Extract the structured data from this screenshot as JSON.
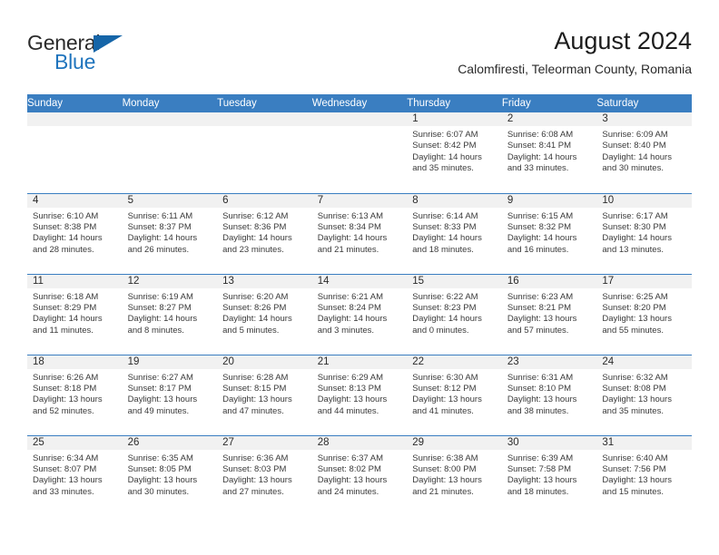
{
  "brand": {
    "name_part1": "General",
    "name_part2": "Blue",
    "logo_icon": "blue-triangle-logo",
    "accent_color": "#1f74bd"
  },
  "header": {
    "title": "August 2024",
    "subtitle": "Calomfiresti, Teleorman County, Romania"
  },
  "calendar": {
    "header_bg": "#3a7ec1",
    "daynum_bg": "#f1f1f1",
    "weekday_headers": [
      "Sunday",
      "Monday",
      "Tuesday",
      "Wednesday",
      "Thursday",
      "Friday",
      "Saturday"
    ],
    "weeks": [
      [
        {
          "day": "",
          "sunrise": "",
          "sunset": "",
          "daylight_line1": "",
          "daylight_line2": ""
        },
        {
          "day": "",
          "sunrise": "",
          "sunset": "",
          "daylight_line1": "",
          "daylight_line2": ""
        },
        {
          "day": "",
          "sunrise": "",
          "sunset": "",
          "daylight_line1": "",
          "daylight_line2": ""
        },
        {
          "day": "",
          "sunrise": "",
          "sunset": "",
          "daylight_line1": "",
          "daylight_line2": ""
        },
        {
          "day": "1",
          "sunrise": "Sunrise: 6:07 AM",
          "sunset": "Sunset: 8:42 PM",
          "daylight_line1": "Daylight: 14 hours",
          "daylight_line2": "and 35 minutes."
        },
        {
          "day": "2",
          "sunrise": "Sunrise: 6:08 AM",
          "sunset": "Sunset: 8:41 PM",
          "daylight_line1": "Daylight: 14 hours",
          "daylight_line2": "and 33 minutes."
        },
        {
          "day": "3",
          "sunrise": "Sunrise: 6:09 AM",
          "sunset": "Sunset: 8:40 PM",
          "daylight_line1": "Daylight: 14 hours",
          "daylight_line2": "and 30 minutes."
        }
      ],
      [
        {
          "day": "4",
          "sunrise": "Sunrise: 6:10 AM",
          "sunset": "Sunset: 8:38 PM",
          "daylight_line1": "Daylight: 14 hours",
          "daylight_line2": "and 28 minutes."
        },
        {
          "day": "5",
          "sunrise": "Sunrise: 6:11 AM",
          "sunset": "Sunset: 8:37 PM",
          "daylight_line1": "Daylight: 14 hours",
          "daylight_line2": "and 26 minutes."
        },
        {
          "day": "6",
          "sunrise": "Sunrise: 6:12 AM",
          "sunset": "Sunset: 8:36 PM",
          "daylight_line1": "Daylight: 14 hours",
          "daylight_line2": "and 23 minutes."
        },
        {
          "day": "7",
          "sunrise": "Sunrise: 6:13 AM",
          "sunset": "Sunset: 8:34 PM",
          "daylight_line1": "Daylight: 14 hours",
          "daylight_line2": "and 21 minutes."
        },
        {
          "day": "8",
          "sunrise": "Sunrise: 6:14 AM",
          "sunset": "Sunset: 8:33 PM",
          "daylight_line1": "Daylight: 14 hours",
          "daylight_line2": "and 18 minutes."
        },
        {
          "day": "9",
          "sunrise": "Sunrise: 6:15 AM",
          "sunset": "Sunset: 8:32 PM",
          "daylight_line1": "Daylight: 14 hours",
          "daylight_line2": "and 16 minutes."
        },
        {
          "day": "10",
          "sunrise": "Sunrise: 6:17 AM",
          "sunset": "Sunset: 8:30 PM",
          "daylight_line1": "Daylight: 14 hours",
          "daylight_line2": "and 13 minutes."
        }
      ],
      [
        {
          "day": "11",
          "sunrise": "Sunrise: 6:18 AM",
          "sunset": "Sunset: 8:29 PM",
          "daylight_line1": "Daylight: 14 hours",
          "daylight_line2": "and 11 minutes."
        },
        {
          "day": "12",
          "sunrise": "Sunrise: 6:19 AM",
          "sunset": "Sunset: 8:27 PM",
          "daylight_line1": "Daylight: 14 hours",
          "daylight_line2": "and 8 minutes."
        },
        {
          "day": "13",
          "sunrise": "Sunrise: 6:20 AM",
          "sunset": "Sunset: 8:26 PM",
          "daylight_line1": "Daylight: 14 hours",
          "daylight_line2": "and 5 minutes."
        },
        {
          "day": "14",
          "sunrise": "Sunrise: 6:21 AM",
          "sunset": "Sunset: 8:24 PM",
          "daylight_line1": "Daylight: 14 hours",
          "daylight_line2": "and 3 minutes."
        },
        {
          "day": "15",
          "sunrise": "Sunrise: 6:22 AM",
          "sunset": "Sunset: 8:23 PM",
          "daylight_line1": "Daylight: 14 hours",
          "daylight_line2": "and 0 minutes."
        },
        {
          "day": "16",
          "sunrise": "Sunrise: 6:23 AM",
          "sunset": "Sunset: 8:21 PM",
          "daylight_line1": "Daylight: 13 hours",
          "daylight_line2": "and 57 minutes."
        },
        {
          "day": "17",
          "sunrise": "Sunrise: 6:25 AM",
          "sunset": "Sunset: 8:20 PM",
          "daylight_line1": "Daylight: 13 hours",
          "daylight_line2": "and 55 minutes."
        }
      ],
      [
        {
          "day": "18",
          "sunrise": "Sunrise: 6:26 AM",
          "sunset": "Sunset: 8:18 PM",
          "daylight_line1": "Daylight: 13 hours",
          "daylight_line2": "and 52 minutes."
        },
        {
          "day": "19",
          "sunrise": "Sunrise: 6:27 AM",
          "sunset": "Sunset: 8:17 PM",
          "daylight_line1": "Daylight: 13 hours",
          "daylight_line2": "and 49 minutes."
        },
        {
          "day": "20",
          "sunrise": "Sunrise: 6:28 AM",
          "sunset": "Sunset: 8:15 PM",
          "daylight_line1": "Daylight: 13 hours",
          "daylight_line2": "and 47 minutes."
        },
        {
          "day": "21",
          "sunrise": "Sunrise: 6:29 AM",
          "sunset": "Sunset: 8:13 PM",
          "daylight_line1": "Daylight: 13 hours",
          "daylight_line2": "and 44 minutes."
        },
        {
          "day": "22",
          "sunrise": "Sunrise: 6:30 AM",
          "sunset": "Sunset: 8:12 PM",
          "daylight_line1": "Daylight: 13 hours",
          "daylight_line2": "and 41 minutes."
        },
        {
          "day": "23",
          "sunrise": "Sunrise: 6:31 AM",
          "sunset": "Sunset: 8:10 PM",
          "daylight_line1": "Daylight: 13 hours",
          "daylight_line2": "and 38 minutes."
        },
        {
          "day": "24",
          "sunrise": "Sunrise: 6:32 AM",
          "sunset": "Sunset: 8:08 PM",
          "daylight_line1": "Daylight: 13 hours",
          "daylight_line2": "and 35 minutes."
        }
      ],
      [
        {
          "day": "25",
          "sunrise": "Sunrise: 6:34 AM",
          "sunset": "Sunset: 8:07 PM",
          "daylight_line1": "Daylight: 13 hours",
          "daylight_line2": "and 33 minutes."
        },
        {
          "day": "26",
          "sunrise": "Sunrise: 6:35 AM",
          "sunset": "Sunset: 8:05 PM",
          "daylight_line1": "Daylight: 13 hours",
          "daylight_line2": "and 30 minutes."
        },
        {
          "day": "27",
          "sunrise": "Sunrise: 6:36 AM",
          "sunset": "Sunset: 8:03 PM",
          "daylight_line1": "Daylight: 13 hours",
          "daylight_line2": "and 27 minutes."
        },
        {
          "day": "28",
          "sunrise": "Sunrise: 6:37 AM",
          "sunset": "Sunset: 8:02 PM",
          "daylight_line1": "Daylight: 13 hours",
          "daylight_line2": "and 24 minutes."
        },
        {
          "day": "29",
          "sunrise": "Sunrise: 6:38 AM",
          "sunset": "Sunset: 8:00 PM",
          "daylight_line1": "Daylight: 13 hours",
          "daylight_line2": "and 21 minutes."
        },
        {
          "day": "30",
          "sunrise": "Sunrise: 6:39 AM",
          "sunset": "Sunset: 7:58 PM",
          "daylight_line1": "Daylight: 13 hours",
          "daylight_line2": "and 18 minutes."
        },
        {
          "day": "31",
          "sunrise": "Sunrise: 6:40 AM",
          "sunset": "Sunset: 7:56 PM",
          "daylight_line1": "Daylight: 13 hours",
          "daylight_line2": "and 15 minutes."
        }
      ]
    ]
  }
}
